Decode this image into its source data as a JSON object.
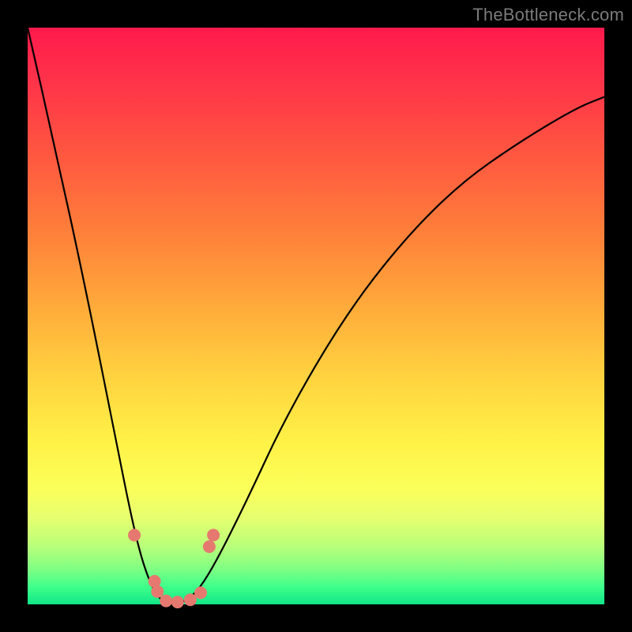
{
  "watermark": "TheBottleneck.com",
  "chart_data": {
    "type": "line",
    "title": "",
    "xlabel": "",
    "ylabel": "",
    "x": [
      0.0,
      0.05,
      0.1,
      0.15,
      0.18,
      0.2,
      0.22,
      0.24,
      0.26,
      0.28,
      0.3,
      0.33,
      0.38,
      0.45,
      0.55,
      0.65,
      0.75,
      0.85,
      0.95,
      1.0
    ],
    "values": [
      1.0,
      0.78,
      0.55,
      0.3,
      0.15,
      0.07,
      0.02,
      0.0,
      0.0,
      0.01,
      0.03,
      0.08,
      0.18,
      0.33,
      0.5,
      0.63,
      0.73,
      0.8,
      0.86,
      0.88
    ],
    "ylim": [
      0,
      1
    ],
    "xlim": [
      0,
      1
    ],
    "grid": false,
    "markers": {
      "color": "#e6796f",
      "points": [
        {
          "x": 0.185,
          "y": 0.12
        },
        {
          "x": 0.22,
          "y": 0.04
        },
        {
          "x": 0.225,
          "y": 0.022
        },
        {
          "x": 0.24,
          "y": 0.006
        },
        {
          "x": 0.26,
          "y": 0.004
        },
        {
          "x": 0.282,
          "y": 0.008
        },
        {
          "x": 0.3,
          "y": 0.02
        },
        {
          "x": 0.315,
          "y": 0.1
        },
        {
          "x": 0.322,
          "y": 0.12
        }
      ]
    }
  },
  "colors": {
    "background": "#000000",
    "curve": "#000000",
    "marker": "#e6796f",
    "watermark": "#7b7b7b"
  }
}
